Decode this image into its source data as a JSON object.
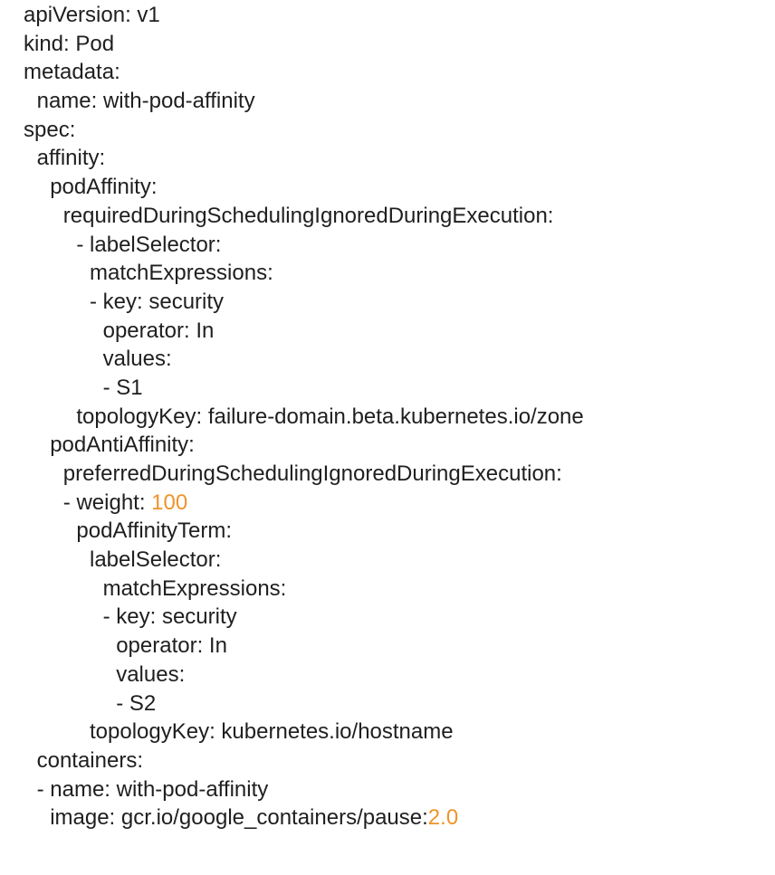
{
  "editor": {
    "accent_number_color": "#f0932a",
    "text_color": "#1f1f1f",
    "lines": [
      {
        "indent": 0,
        "text": "apiVersion: v1",
        "value": ""
      },
      {
        "indent": 0,
        "text": "kind: Pod",
        "value": ""
      },
      {
        "indent": 0,
        "text": "metadata:",
        "value": ""
      },
      {
        "indent": 1,
        "text": "name: with-pod-affinity",
        "value": ""
      },
      {
        "indent": 0,
        "text": "spec:",
        "value": ""
      },
      {
        "indent": 1,
        "text": "affinity:",
        "value": ""
      },
      {
        "indent": 2,
        "text": "podAffinity:",
        "value": ""
      },
      {
        "indent": 3,
        "text": "requiredDuringSchedulingIgnoredDuringExecution:",
        "value": ""
      },
      {
        "indent": 4,
        "text": "- labelSelector:",
        "value": ""
      },
      {
        "indent": 5,
        "text": "matchExpressions:",
        "value": ""
      },
      {
        "indent": 5,
        "text": "- key: security",
        "value": ""
      },
      {
        "indent": 6,
        "text": "operator: In",
        "value": ""
      },
      {
        "indent": 6,
        "text": "values:",
        "value": ""
      },
      {
        "indent": 6,
        "text": "- S1",
        "value": ""
      },
      {
        "indent": 4,
        "text": "topologyKey: failure-domain.beta.kubernetes.io/zone",
        "value": ""
      },
      {
        "indent": 2,
        "text": "podAntiAffinity:",
        "value": ""
      },
      {
        "indent": 3,
        "text": "preferredDuringSchedulingIgnoredDuringExecution:",
        "value": ""
      },
      {
        "indent": 3,
        "text": "- weight: ",
        "value": "100"
      },
      {
        "indent": 4,
        "text": "podAffinityTerm:",
        "value": ""
      },
      {
        "indent": 5,
        "text": "labelSelector:",
        "value": ""
      },
      {
        "indent": 6,
        "text": "matchExpressions:",
        "value": ""
      },
      {
        "indent": 6,
        "text": "- key: security",
        "value": ""
      },
      {
        "indent": 7,
        "text": "operator: In",
        "value": ""
      },
      {
        "indent": 7,
        "text": "values:",
        "value": ""
      },
      {
        "indent": 7,
        "text": "- S2",
        "value": ""
      },
      {
        "indent": 5,
        "text": "topologyKey: kubernetes.io/hostname",
        "value": ""
      },
      {
        "indent": 1,
        "text": "containers:",
        "value": ""
      },
      {
        "indent": 1,
        "text": "- name: with-pod-affinity",
        "value": ""
      },
      {
        "indent": 2,
        "text": "image: gcr.io/google_containers/pause:",
        "value": "2.0"
      }
    ]
  }
}
